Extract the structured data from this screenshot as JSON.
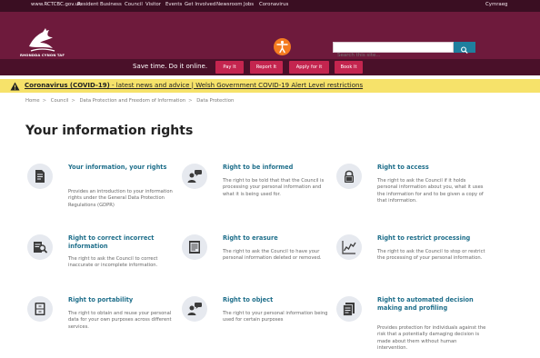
{
  "top_nav": {
    "items": [
      {
        "label": "www.RCTCBC.gov.uk"
      },
      {
        "label": "Resident"
      },
      {
        "label": "Business"
      },
      {
        "label": "Council"
      },
      {
        "label": "Visitor"
      },
      {
        "label": "Events"
      },
      {
        "label": "Get Involved"
      },
      {
        "label": "Newsroom"
      },
      {
        "label": "Jobs"
      },
      {
        "label": "Coronavirus"
      }
    ],
    "language": "Cymraeg"
  },
  "header": {
    "logo_text": "RHONDDA CYNON TAF",
    "search_placeholder": "Search this site...",
    "accessibility_icon": "accessibility-icon",
    "search_icon": "search-icon"
  },
  "action_bar": {
    "tagline": "Save time. Do it online.",
    "buttons": [
      {
        "label": "Pay It"
      },
      {
        "label": "Report It"
      },
      {
        "label": "Apply for it"
      },
      {
        "label": "Book It"
      }
    ]
  },
  "alert": {
    "bold": "Coronavirus (COVID-19)",
    "rest": " - latest news and advice | Welsh Government COVID-19 Alert Level restrictions"
  },
  "breadcrumb": [
    "Home",
    "Council",
    "Data Protection and Freedom of Information",
    "Data Protection"
  ],
  "page_title": "Your information rights",
  "cards": [
    {
      "icon": "document-icon",
      "title": "Your information, your rights",
      "desc": "Provides an introduction to your information rights under the General Data Protection Regulations (GDPR)"
    },
    {
      "icon": "person-speech-icon",
      "title": "Right to be informed",
      "desc": "The right to be told that that the Council is processing your personal information and what it is being used for."
    },
    {
      "icon": "lock-icon",
      "title": "Right to access",
      "desc": "The right to ask the Council if it holds personal information about you, what it uses the information for and to be given a copy of that information."
    },
    {
      "icon": "search-document-icon",
      "title": "Right to correct incorrect information",
      "desc": "The right to ask the Council to correct inaccurate or incomplete information."
    },
    {
      "icon": "list-document-icon",
      "title": "Right to erasure",
      "desc": "The right to ask the Council to have your personal information deleted or removed."
    },
    {
      "icon": "line-chart-icon",
      "title": "Right to restrict processing",
      "desc": "The right to ask the Council to stop or restrict the processing of your personal information."
    },
    {
      "icon": "cabinet-icon",
      "title": "Right to portability",
      "desc": "The right to obtain and reuse your personal data for your own purposes across different services."
    },
    {
      "icon": "person-speech-icon",
      "title": "Right to object",
      "desc": "The right to your personal information being used for certain purposes"
    },
    {
      "icon": "documents-icon",
      "title": "Right to automated decision making and profiling",
      "desc": "Provides protection for individuals against the risk that a potentially damaging decision is made about them without human intervention."
    }
  ],
  "colors": {
    "brand": "#6e1a3c",
    "action": "#c4254f",
    "link": "#1f6f8b",
    "alert": "#f6e26a"
  }
}
